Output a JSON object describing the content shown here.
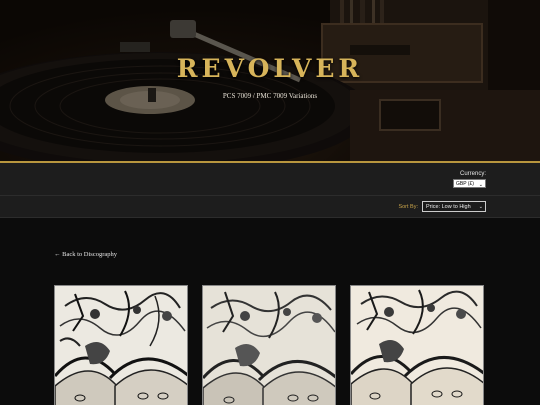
{
  "hero": {
    "title": "REVOLVER",
    "subtitle": "PCS 7009 / PMC 7009 Variations"
  },
  "currency": {
    "label": "Currency:",
    "selected": "GBP (£)"
  },
  "sort": {
    "label": "Sort By:",
    "selected": "Price: Low to High"
  },
  "nav": {
    "back_label": "← Back to Discography"
  },
  "products": [
    {
      "image": "revolver-cover-variation-1"
    },
    {
      "image": "revolver-cover-variation-2"
    },
    {
      "image": "revolver-cover-variation-3"
    }
  ],
  "colors": {
    "accent_gold": "#c9a44a",
    "background": "#0c0c0c",
    "bar": "#1d1d1d"
  }
}
